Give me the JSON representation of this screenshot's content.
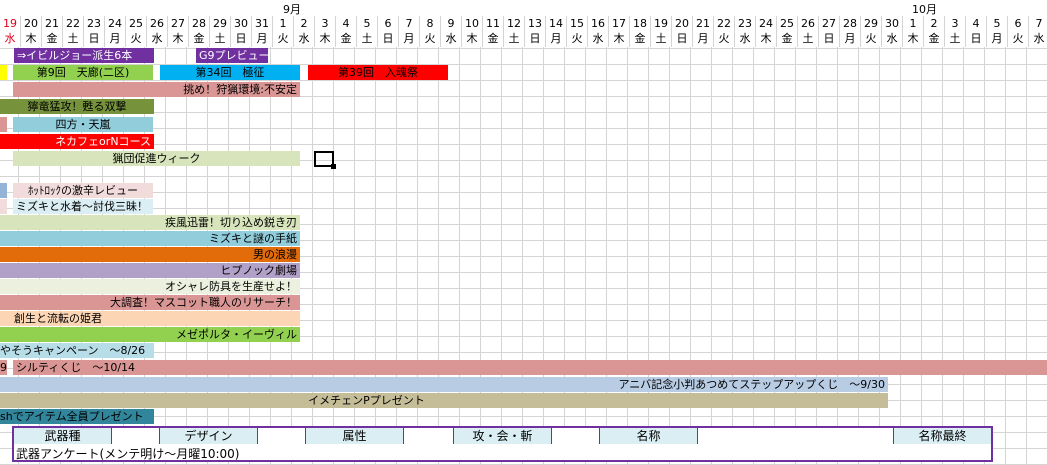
{
  "calendar": {
    "months": {
      "september": "9月",
      "october": "10月"
    },
    "dates": [
      "19",
      "20",
      "21",
      "22",
      "23",
      "24",
      "25",
      "26",
      "27",
      "28",
      "29",
      "30",
      "31",
      "1",
      "2",
      "3",
      "4",
      "5",
      "6",
      "7",
      "8",
      "9",
      "10",
      "11",
      "12",
      "13",
      "14",
      "15",
      "16",
      "17",
      "18",
      "19",
      "20",
      "21",
      "22",
      "23",
      "24",
      "25",
      "26",
      "27",
      "28",
      "29",
      "30",
      "1",
      "2",
      "3",
      "4",
      "5",
      "6",
      "7"
    ],
    "weekdays": [
      "水",
      "木",
      "金",
      "土",
      "日",
      "月",
      "火",
      "水",
      "木",
      "金",
      "土",
      "日",
      "月",
      "火",
      "水",
      "木",
      "金",
      "土",
      "日",
      "月",
      "火",
      "水",
      "木",
      "金",
      "土",
      "日",
      "月",
      "火",
      "水",
      "木",
      "金",
      "土",
      "日",
      "月",
      "火",
      "水",
      "木",
      "金",
      "土",
      "日",
      "月",
      "火",
      "水",
      "木",
      "金",
      "土",
      "日",
      "月",
      "火",
      "水"
    ],
    "today_color": "#e0001b"
  },
  "events": [
    {
      "label": "⇒イビルジョー派生6本",
      "color": "#7030a0",
      "text_color": "#ffffff"
    },
    {
      "label": "G9プレビュー",
      "color": "#7030a0",
      "text_color": "#ffffff"
    },
    {
      "label": "",
      "color": "#ffff00"
    },
    {
      "label": "第9回　天廊(二区)",
      "color": "#92d050"
    },
    {
      "label": "第34回　極征",
      "color": "#00b0f0"
    },
    {
      "label": "第39回　入魂祭",
      "color": "#ff0000"
    },
    {
      "label": "挑め！狩猟環境:不安定",
      "color": "#da9694"
    },
    {
      "label": "獰竜猛攻！甦る双撃",
      "color": "#76933c"
    },
    {
      "label": "",
      "color": "#da9694"
    },
    {
      "label": "四方・天嵐",
      "color": "#92cddc"
    },
    {
      "label": "ネカフェorNコース",
      "color": "#ff0000",
      "text_color": "#ffffff"
    },
    {
      "label": "猟団促進ウィーク",
      "color": "#d8e4bc"
    },
    {
      "label": "",
      "color": "#95b3d7"
    },
    {
      "label": "ﾎｯﾄﾛｯｸの激辛レビュー",
      "color": "#f2dcdb"
    },
    {
      "label": "",
      "color": "#f2dcdb"
    },
    {
      "label": "ミズキと水着～討伐三昧！",
      "color": "#daeef3"
    },
    {
      "label": "疾風迅雷！切り込め鋭き刃",
      "color": "#d8e4bc"
    },
    {
      "label": "ミズキと謎の手紙",
      "color": "#92cddc"
    },
    {
      "label": "男の浪漫",
      "color": "#e26b0a"
    },
    {
      "label": "ヒプノック劇場",
      "color": "#b1a0c7"
    },
    {
      "label": "オシャレ防具を生産せよ！",
      "color": "#ebf1de"
    },
    {
      "label": "大調査！マスコット職人のリサーチ！",
      "color": "#da9694"
    },
    {
      "label": "創生と流転の姫君",
      "color": "#fcd5b4"
    },
    {
      "label": "メゼポルタ・イーヴィル",
      "color": "#92d050"
    },
    {
      "label": "やそうキャンペーン　～8/26",
      "color": "#b7dee8"
    },
    {
      "label": "9",
      "color": "#da9694"
    },
    {
      "label": "シルティくじ　～10/14",
      "color": "#da9694"
    },
    {
      "label": "アニバ記念小判あつめてステップアップくじ　～9/30",
      "color": "#b8cce4"
    },
    {
      "label": "イメチェンPプレゼント",
      "color": "#c4bd97"
    },
    {
      "label": "shでアイテム全員プレゼント",
      "color": "#31869b"
    }
  ],
  "survey": {
    "headers": [
      "武器種",
      "デザイン",
      "属性",
      "攻・会・斬",
      "名称",
      "名称最終"
    ],
    "note": "武器アンケート(メンテ明け～月曜10:00)",
    "border_color": "#7030a0",
    "header_color": "#daeef3"
  }
}
